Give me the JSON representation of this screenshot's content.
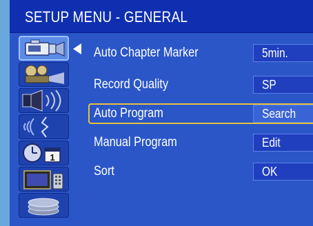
{
  "title": "SETUP MENU - GENERAL",
  "sidebar": {
    "items": [
      {
        "icon": "camcorder-icon",
        "active": true
      },
      {
        "icon": "film-projector-icon",
        "active": false
      },
      {
        "icon": "speaker-icon",
        "active": false
      },
      {
        "icon": "broadcast-signal-icon",
        "active": false
      },
      {
        "icon": "clock-calendar-icon",
        "active": false
      },
      {
        "icon": "tv-remote-icon",
        "active": false
      },
      {
        "icon": "disc-stack-icon",
        "active": false
      }
    ]
  },
  "menu": {
    "rows": [
      {
        "label": "Auto Chapter Marker",
        "value": "5min."
      },
      {
        "label": "Record Quality",
        "value": "SP"
      },
      {
        "label": "Auto Program",
        "value": "Search",
        "selected": true
      },
      {
        "label": "Manual Program",
        "value": "Edit"
      },
      {
        "label": "Sort",
        "value": "OK"
      }
    ]
  },
  "colors": {
    "background": "#2a56c8",
    "titlebar": "#0f2fb0",
    "selection_outline": "#e8c23a",
    "text": "#ffffff"
  }
}
